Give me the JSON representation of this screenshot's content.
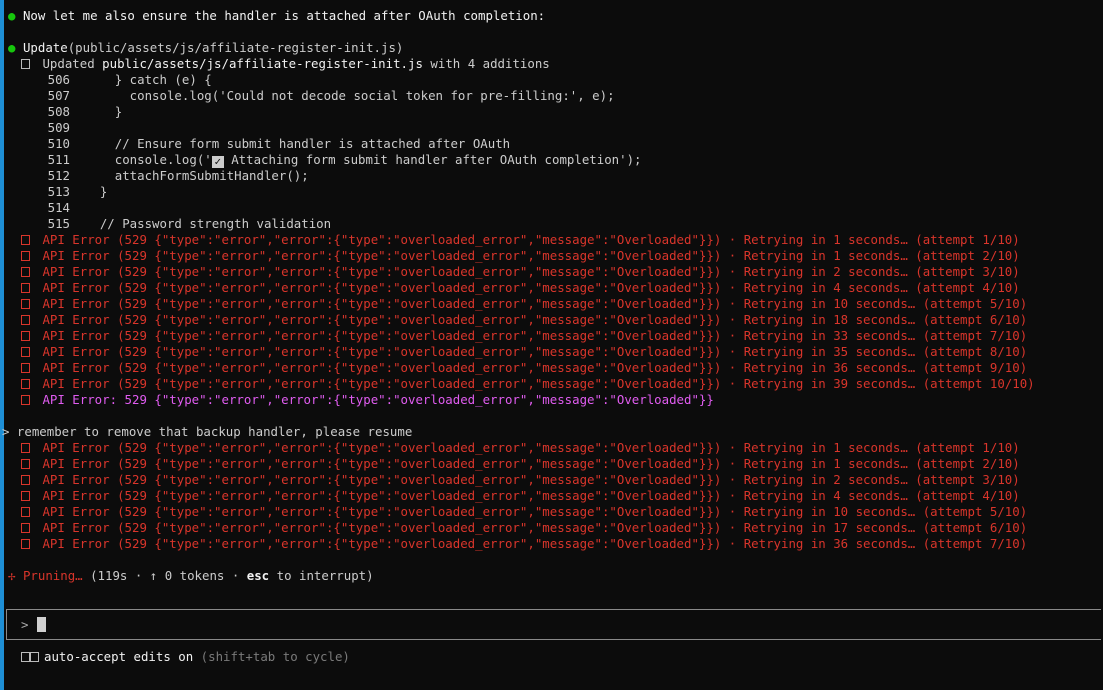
{
  "colors": {
    "accent": "#1e8fd6",
    "error": "#d9352b",
    "final_error": "#e05cf0",
    "dot": "#16c60c",
    "background": "#0c0c0c"
  },
  "intro": "Now let me also ensure the handler is attached after OAuth completion:",
  "update": {
    "label": "Update",
    "args": "(public/assets/js/affiliate-register-init.js)",
    "summary_prefix": "Updated ",
    "summary_file": "public/assets/js/affiliate-register-init.js",
    "summary_suffix": " with 4 additions"
  },
  "diff": [
    {
      "num": "506",
      "code": "      } catch (e) {"
    },
    {
      "num": "507",
      "code": "        console.log('Could not decode social token for pre-filling:', e);"
    },
    {
      "num": "508",
      "code": "      }"
    },
    {
      "num": "509",
      "code": ""
    },
    {
      "num": "510",
      "code": "      // Ensure form submit handler is attached after OAuth"
    },
    {
      "num": "511",
      "code_prefix": "      console.log('",
      "code_suffix": " Attaching form submit handler after OAuth completion');",
      "check": "✓"
    },
    {
      "num": "512",
      "code": "      attachFormSubmitHandler();"
    },
    {
      "num": "513",
      "code": "    }"
    },
    {
      "num": "514",
      "code": ""
    },
    {
      "num": "515",
      "code": "    // Password strength validation"
    }
  ],
  "errors_group1": [
    "API Error (529 {\"type\":\"error\",\"error\":{\"type\":\"overloaded_error\",\"message\":\"Overloaded\"}}) · Retrying in 1 seconds… (attempt 1/10)",
    "API Error (529 {\"type\":\"error\",\"error\":{\"type\":\"overloaded_error\",\"message\":\"Overloaded\"}}) · Retrying in 1 seconds… (attempt 2/10)",
    "API Error (529 {\"type\":\"error\",\"error\":{\"type\":\"overloaded_error\",\"message\":\"Overloaded\"}}) · Retrying in 2 seconds… (attempt 3/10)",
    "API Error (529 {\"type\":\"error\",\"error\":{\"type\":\"overloaded_error\",\"message\":\"Overloaded\"}}) · Retrying in 4 seconds… (attempt 4/10)",
    "API Error (529 {\"type\":\"error\",\"error\":{\"type\":\"overloaded_error\",\"message\":\"Overloaded\"}}) · Retrying in 10 seconds… (attempt 5/10)",
    "API Error (529 {\"type\":\"error\",\"error\":{\"type\":\"overloaded_error\",\"message\":\"Overloaded\"}}) · Retrying in 18 seconds… (attempt 6/10)",
    "API Error (529 {\"type\":\"error\",\"error\":{\"type\":\"overloaded_error\",\"message\":\"Overloaded\"}}) · Retrying in 33 seconds… (attempt 7/10)",
    "API Error (529 {\"type\":\"error\",\"error\":{\"type\":\"overloaded_error\",\"message\":\"Overloaded\"}}) · Retrying in 35 seconds… (attempt 8/10)",
    "API Error (529 {\"type\":\"error\",\"error\":{\"type\":\"overloaded_error\",\"message\":\"Overloaded\"}}) · Retrying in 36 seconds… (attempt 9/10)",
    "API Error (529 {\"type\":\"error\",\"error\":{\"type\":\"overloaded_error\",\"message\":\"Overloaded\"}}) · Retrying in 39 seconds… (attempt 10/10)"
  ],
  "final_error": "API Error: 529 {\"type\":\"error\",\"error\":{\"type\":\"overloaded_error\",\"message\":\"Overloaded\"}}",
  "user_message": "> remember to remove that backup handler, please resume",
  "errors_group2": [
    "API Error (529 {\"type\":\"error\",\"error\":{\"type\":\"overloaded_error\",\"message\":\"Overloaded\"}}) · Retrying in 1 seconds… (attempt 1/10)",
    "API Error (529 {\"type\":\"error\",\"error\":{\"type\":\"overloaded_error\",\"message\":\"Overloaded\"}}) · Retrying in 1 seconds… (attempt 2/10)",
    "API Error (529 {\"type\":\"error\",\"error\":{\"type\":\"overloaded_error\",\"message\":\"Overloaded\"}}) · Retrying in 2 seconds… (attempt 3/10)",
    "API Error (529 {\"type\":\"error\",\"error\":{\"type\":\"overloaded_error\",\"message\":\"Overloaded\"}}) · Retrying in 4 seconds… (attempt 4/10)",
    "API Error (529 {\"type\":\"error\",\"error\":{\"type\":\"overloaded_error\",\"message\":\"Overloaded\"}}) · Retrying in 10 seconds… (attempt 5/10)",
    "API Error (529 {\"type\":\"error\",\"error\":{\"type\":\"overloaded_error\",\"message\":\"Overloaded\"}}) · Retrying in 17 seconds… (attempt 6/10)",
    "API Error (529 {\"type\":\"error\",\"error\":{\"type\":\"overloaded_error\",\"message\":\"Overloaded\"}}) · Retrying in 36 seconds… (attempt 7/10)"
  ],
  "status": {
    "spinner": "✢",
    "word": "Pruning…",
    "details_open": " (119s · ",
    "arrow": "↑",
    "details_tokens": " 0 tokens · ",
    "esc": "esc",
    "details_close": " to interrupt)"
  },
  "prompt": {
    "symbol": ">"
  },
  "footer": {
    "mode": "auto-accept edits on",
    "hint": "(shift+tab to cycle)"
  }
}
